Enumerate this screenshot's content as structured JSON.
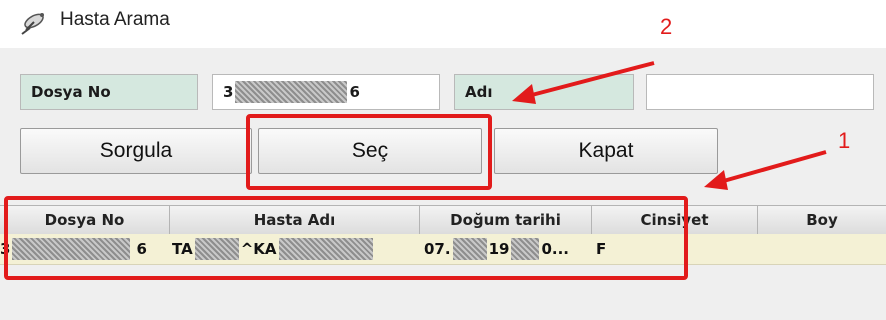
{
  "window": {
    "title": "Hasta Arama",
    "icon": "satellite-dish-icon"
  },
  "form": {
    "dosya_no_label": "Dosya No",
    "dosya_no_value_start": "3",
    "dosya_no_value_end": "6",
    "adi_label": "Adı",
    "adi_value": ""
  },
  "buttons": {
    "sorgula": "Sorgula",
    "sec": "Seç",
    "kapat": "Kapat"
  },
  "grid": {
    "columns": [
      "Dosya No",
      "Hasta Adı",
      "Doğum tarihi",
      "Cinsiyet",
      "Boy"
    ],
    "rows": [
      {
        "dosya_no_start": "3",
        "dosya_no_end": "6",
        "hasta_adi_1": "TA",
        "hasta_adi_2": "^KA",
        "dogum_1": "07.",
        "dogum_2": "19",
        "dogum_3": "0...",
        "cinsiyet": "F",
        "boy": ""
      }
    ]
  },
  "annotations": {
    "marker_1": "1",
    "marker_2": "2",
    "color": "#e21b1b"
  }
}
